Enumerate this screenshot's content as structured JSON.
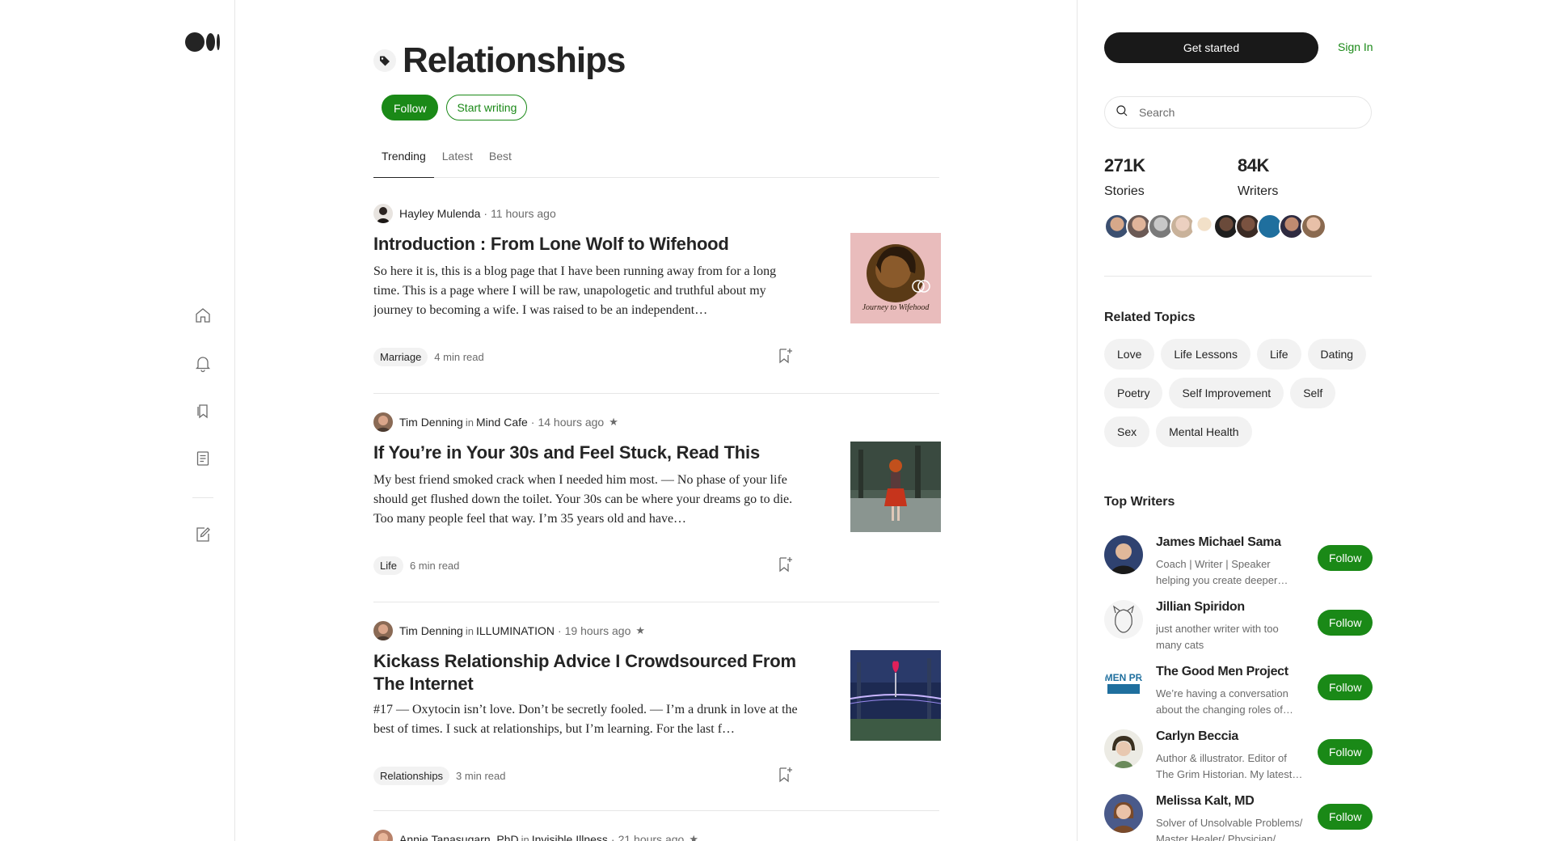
{
  "rail": {
    "icons": [
      "home-icon",
      "notifications-icon",
      "library-icon",
      "stories-icon",
      "write-icon"
    ]
  },
  "topic": {
    "title": "Relationships",
    "follow_label": "Follow",
    "start_writing_label": "Start writing"
  },
  "tabs": [
    {
      "label": "Trending",
      "active": true
    },
    {
      "label": "Latest",
      "active": false
    },
    {
      "label": "Best",
      "active": false
    }
  ],
  "articles": [
    {
      "author": "Hayley Mulenda",
      "in": "",
      "publication": "",
      "time": "11 hours ago",
      "starred": false,
      "title": "Introduction : From Lone Wolf to Wifehood",
      "excerpt": "So here it is, this is a blog page that I have been running away from for a long time. This is a page where I will be raw, unapologetic and truthful about my journey to becoming a wife. I was raised to be an independent…",
      "tag": "Marriage",
      "read_time": "4 min read",
      "thumb_text": "Journey to Wifehood"
    },
    {
      "author": "Tim Denning",
      "in": "in",
      "publication": "Mind Cafe",
      "time": "14 hours ago",
      "starred": true,
      "title": "If You’re in Your 30s and Feel Stuck, Read This",
      "excerpt": "My best friend smoked crack when I needed him most. — No phase of your life should get flushed down the toilet. Your 30s can be where your dreams go to die. Too many people feel that way. I’m 35 years old and have…",
      "tag": "Life",
      "read_time": "6 min read"
    },
    {
      "author": "Tim Denning",
      "in": "in",
      "publication": "ILLUMINATION",
      "time": "19 hours ago",
      "starred": true,
      "title": "Kickass Relationship Advice I Crowdsourced From The Internet",
      "excerpt": "#17 — Oxytocin isn’t love. Don’t be secretly fooled. — I’m a drunk in love at the best of times. I suck at relationships, but I’m learning. For the last f…",
      "tag": "Relationships",
      "read_time": "3 min read"
    },
    {
      "author": "Annie Tanasugarn, PhD",
      "in": "in",
      "publication": "Invisible Illness",
      "time": "21 hours ago",
      "starred": true
    }
  ],
  "sidebar": {
    "get_started_label": "Get started",
    "sign_in_label": "Sign In",
    "search_placeholder": "Search",
    "stories_count": "271K",
    "stories_label": "Stories",
    "writers_count": "84K",
    "writers_label": "Writers",
    "related_topics_title": "Related Topics",
    "related_topics": [
      "Love",
      "Life Lessons",
      "Life",
      "Dating",
      "Poetry",
      "Self Improvement",
      "Self",
      "Sex",
      "Mental Health"
    ],
    "top_writers_title": "Top Writers",
    "top_writers": [
      {
        "name": "James Michael Sama",
        "bio": "Coach | Writer | Speaker helping you create deeper…",
        "follow": "Follow"
      },
      {
        "name": "Jillian Spiridon",
        "bio": "just another writer with too many cats",
        "follow": "Follow"
      },
      {
        "name": "The Good Men Project",
        "bio": "We’re having a conversation about the changing roles of…",
        "follow": "Follow",
        "logo_text": "GOOD MEN PROJECT"
      },
      {
        "name": "Carlyn Beccia",
        "bio": "Author & illustrator. Editor of The Grim Historian. My latest…",
        "follow": "Follow"
      },
      {
        "name": "Melissa Kalt, MD",
        "bio": "Solver of Unsolvable Problems/ Master Healer/ Physician/…",
        "follow": "Follow"
      }
    ]
  },
  "colors": {
    "accent_green": "#1a8917",
    "text_primary": "#242424",
    "text_secondary": "#6b6b6b",
    "chip_bg": "#f2f2f2",
    "dark_button": "#191919"
  }
}
